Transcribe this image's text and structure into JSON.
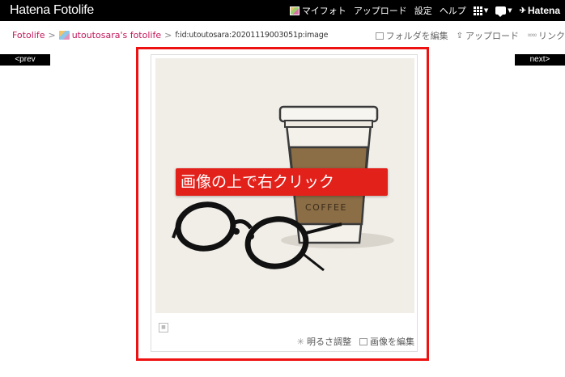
{
  "header": {
    "brand": "Hatena Fotolife",
    "nav": {
      "myfoto": "マイフォト",
      "upload": "アップロード",
      "settings": "設定",
      "help": "ヘルプ",
      "hatena": "Hatena"
    }
  },
  "breadcrumb": {
    "root": "Fotolife",
    "sep1": ">",
    "user": "utoutosara's fotolife",
    "sep2": ">",
    "path": "f:id:utoutosara:20201119003051p:image"
  },
  "tools": {
    "edit_folder": "フォルダを編集",
    "upload": "アップロード",
    "link": "リンク"
  },
  "pager": {
    "prev": "<prev",
    "next": "next>"
  },
  "photo": {
    "cup_text": "COFFEE"
  },
  "callout": {
    "text": "画像の上で右クリック"
  },
  "bottom_tools": {
    "brightness": "明るさ調整",
    "edit_image": "画像を編集"
  },
  "colors": {
    "topbar": "#000000",
    "link": "#c2185b",
    "highlight": "#e11111",
    "callout": "#e3211b"
  }
}
